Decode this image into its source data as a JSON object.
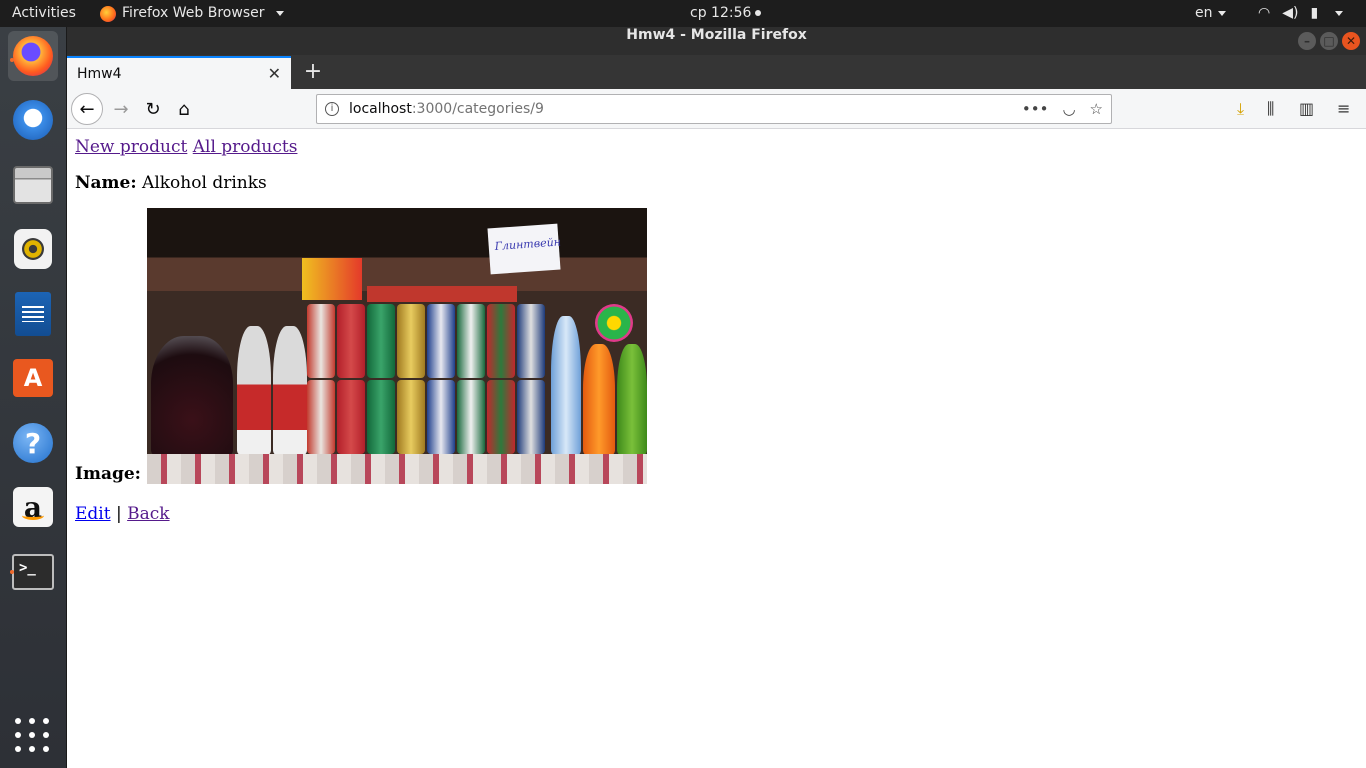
{
  "system": {
    "activities": "Activities",
    "app_name": "Firefox Web Browser",
    "clock": "ср 12:56",
    "language": "en"
  },
  "dock": {
    "items": [
      {
        "name": "firefox-icon",
        "active": true
      },
      {
        "name": "thunderbird-icon"
      },
      {
        "name": "files-icon"
      },
      {
        "name": "rhythmbox-icon"
      },
      {
        "name": "writer-icon"
      },
      {
        "name": "software-store-icon"
      },
      {
        "name": "help-icon"
      },
      {
        "name": "amazon-icon"
      },
      {
        "name": "terminal-icon",
        "running": true
      },
      {
        "name": "show-applications-icon"
      }
    ]
  },
  "window": {
    "title": "Hmw4 - Mozilla Firefox"
  },
  "tabs": [
    {
      "label": "Hmw4",
      "close": "✕"
    }
  ],
  "new_tab_label": "+",
  "urlbar": {
    "host": "localhost",
    "path": ":3000/categories/9",
    "more": "•••"
  },
  "page": {
    "links_top": [
      {
        "label": "New product"
      },
      {
        "label": "All products"
      }
    ],
    "name_label": "Name:",
    "name_value": "Alkohol drinks",
    "image_label": "Image:",
    "image_sign_text": "Глинтвейн",
    "links_bottom": [
      {
        "label": "Edit"
      },
      {
        "label": "Back"
      }
    ],
    "separator": "|"
  }
}
